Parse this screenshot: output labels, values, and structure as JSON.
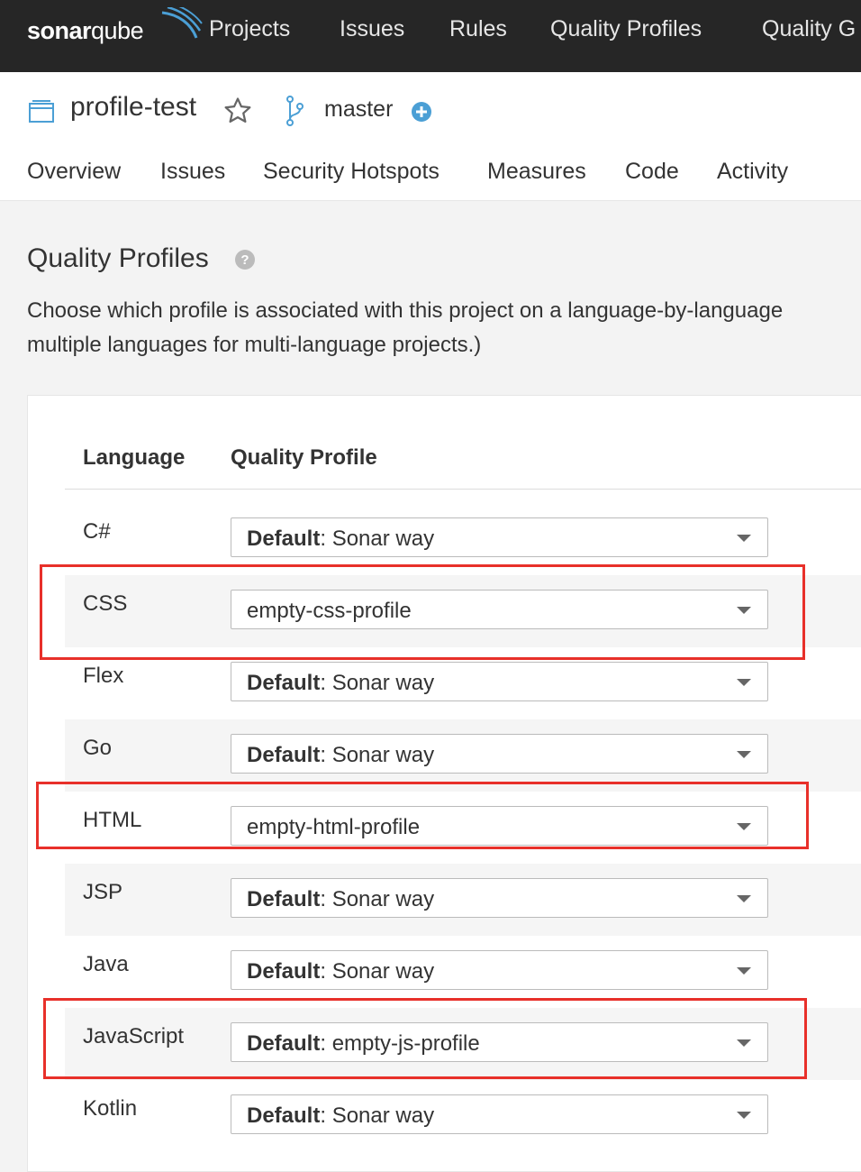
{
  "topnav": {
    "logo_text_bold": "sonar",
    "logo_text": "qube",
    "items": [
      "Projects",
      "Issues",
      "Rules",
      "Quality Profiles",
      "Quality G"
    ]
  },
  "project": {
    "name": "profile-test",
    "branch": "master",
    "tabs": [
      "Overview",
      "Issues",
      "Security Hotspots",
      "Measures",
      "Code",
      "Activity"
    ]
  },
  "section": {
    "title": "Quality Profiles",
    "description_lines": [
      "Choose which profile is associated with this project on a language-by-language",
      "multiple languages for multi-language projects.)"
    ]
  },
  "table": {
    "headers": [
      "Language",
      "Quality Profile"
    ],
    "rows": [
      {
        "language": "C#",
        "default_label": "Default",
        "sep": ": ",
        "profile": "Sonar way"
      },
      {
        "language": "CSS",
        "default_label": "",
        "sep": "",
        "profile": "empty-css-profile"
      },
      {
        "language": "Flex",
        "default_label": "Default",
        "sep": ": ",
        "profile": "Sonar way"
      },
      {
        "language": "Go",
        "default_label": "Default",
        "sep": ": ",
        "profile": "Sonar way"
      },
      {
        "language": "HTML",
        "default_label": "",
        "sep": "",
        "profile": "empty-html-profile"
      },
      {
        "language": "JSP",
        "default_label": "Default",
        "sep": ": ",
        "profile": "Sonar way"
      },
      {
        "language": "Java",
        "default_label": "Default",
        "sep": ": ",
        "profile": "Sonar way"
      },
      {
        "language": "JavaScript",
        "default_label": "Default",
        "sep": ": ",
        "profile": "empty-js-profile"
      },
      {
        "language": "Kotlin",
        "default_label": "Default",
        "sep": ": ",
        "profile": "Sonar way"
      }
    ]
  },
  "colors": {
    "topnav_bg": "#262626",
    "accent_blue": "#4b9fd5",
    "highlight_red": "#e8302a"
  },
  "icons": {
    "project": "project-icon",
    "favorite": "star-icon",
    "branch": "branch-icon",
    "add": "plus-circle-icon",
    "help": "help-icon",
    "dropdown": "caret-down-icon"
  }
}
